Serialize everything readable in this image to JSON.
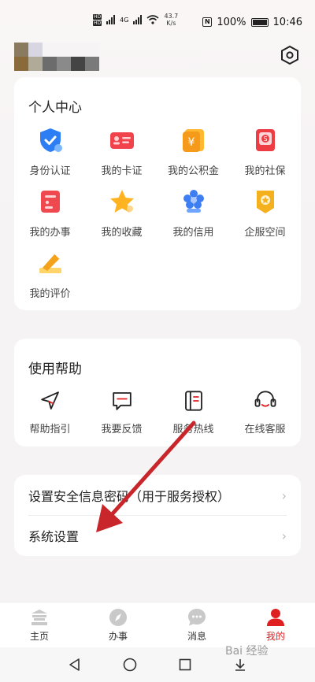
{
  "status_bar": {
    "sim1": "HD",
    "sim2": "HD",
    "network": "4G",
    "speed": "43.7",
    "speed_unit": "K/s",
    "nfc": "N",
    "battery": "100%",
    "time": "10:46"
  },
  "personal_center": {
    "title": "个人中心",
    "items": [
      {
        "label": "身份认证",
        "icon": "shield-check-icon"
      },
      {
        "label": "我的卡证",
        "icon": "id-card-icon"
      },
      {
        "label": "我的公积金",
        "icon": "yuan-wallet-icon"
      },
      {
        "label": "我的社保",
        "icon": "social-security-card-icon"
      },
      {
        "label": "我的办事",
        "icon": "document-icon"
      },
      {
        "label": "我的收藏",
        "icon": "star-icon"
      },
      {
        "label": "我的信用",
        "icon": "flower-badge-icon"
      },
      {
        "label": "企服空间",
        "icon": "enterprise-badge-icon"
      },
      {
        "label": "我的评价",
        "icon": "pencil-icon"
      }
    ]
  },
  "help": {
    "title": "使用帮助",
    "items": [
      {
        "label": "帮助指引",
        "icon": "navigation-arrow-icon"
      },
      {
        "label": "我要反馈",
        "icon": "feedback-message-icon"
      },
      {
        "label": "服务热线",
        "icon": "phone-book-icon"
      },
      {
        "label": "在线客服",
        "icon": "headset-icon"
      }
    ]
  },
  "settings_list": {
    "items": [
      {
        "label": "设置安全信息密码（用于服务授权）"
      },
      {
        "label": "系统设置"
      }
    ],
    "chevron": "›"
  },
  "tabbar": {
    "tabs": [
      {
        "label": "主页",
        "icon": "temple-icon",
        "active": false
      },
      {
        "label": "办事",
        "icon": "compass-icon",
        "active": false
      },
      {
        "label": "消息",
        "icon": "chat-bubble-icon",
        "active": false
      },
      {
        "label": "我的",
        "icon": "person-icon",
        "active": true
      }
    ]
  },
  "colors": {
    "accent": "#e02020",
    "annotation_arrow": "#c8262a"
  },
  "watermark": "Bai 经验"
}
